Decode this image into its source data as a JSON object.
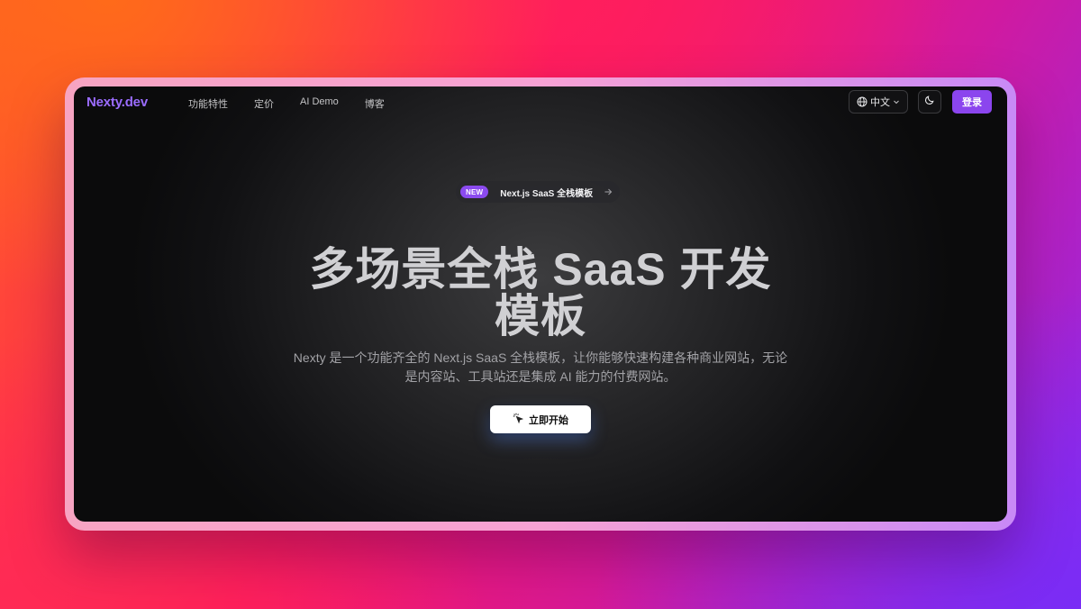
{
  "nav": {
    "logo": "Nexty.dev",
    "links": [
      {
        "label": "功能特性"
      },
      {
        "label": "定价"
      },
      {
        "label": "AI Demo"
      },
      {
        "label": "博客"
      }
    ],
    "language": "中文",
    "login_label": "登录",
    "icons": {
      "language": "globe-icon",
      "language_caret": "chevron-down-icon",
      "theme": "moon-icon"
    }
  },
  "announcement": {
    "badge": "NEW",
    "text": "Next.js SaaS 全栈模板",
    "icon": "arrow-right-icon"
  },
  "hero": {
    "title_line1": "多场景全栈 SaaS 开发",
    "title_line2": "模板",
    "description_line1": "Nexty 是一个功能齐全的 Next.js SaaS 全栈模板，让你能够快速构建各种商业网站，无论",
    "description_line2": "是内容站、工具站还是集成 AI 能力的付费网站。",
    "cta_label": "立即开始",
    "cta_icon": "sparkle-cursor-icon"
  },
  "colors": {
    "brand": "#9b6cff",
    "login": "#8b45ee",
    "badge": "#8b4aef"
  }
}
